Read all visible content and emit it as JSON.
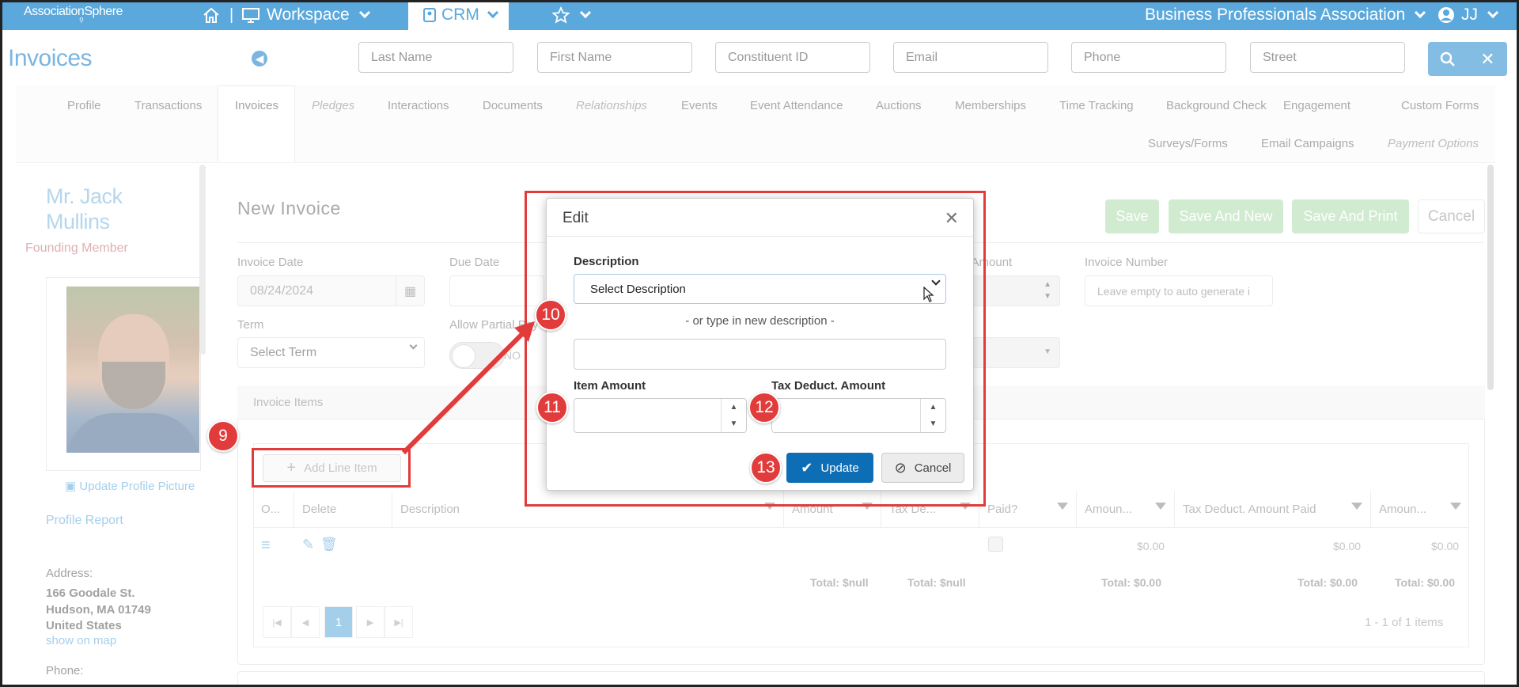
{
  "topbar": {
    "logo": "AssociationSphere",
    "workspace": "Workspace",
    "crm": "CRM",
    "org": "Business Professionals Association",
    "user": "JJ",
    "icons": [
      "home-icon",
      "desktop-icon",
      "crm-icon",
      "star-icon",
      "user-circle-icon"
    ]
  },
  "page": {
    "title": "Invoices"
  },
  "search": {
    "last_name": "Last Name",
    "first_name": "First Name",
    "constituent_id": "Constituent ID",
    "email": "Email",
    "phone": "Phone",
    "street": "Street"
  },
  "tabs": {
    "row1": [
      "Profile",
      "Transactions",
      "Invoices",
      "Pledges",
      "Interactions",
      "Documents",
      "Relationships",
      "Events",
      "Event Attendance",
      "Auctions",
      "Memberships",
      "Time Tracking",
      "Background Check",
      "Engagement",
      "Custom Forms"
    ],
    "row2": [
      "Surveys/Forms",
      "Email Campaigns",
      "Payment Options"
    ],
    "active": "Invoices"
  },
  "profile": {
    "name_line1": "Mr. Jack",
    "name_line2": "Mullins",
    "member_type": "Founding Member",
    "update_picture": "Update Profile Picture",
    "report": "Profile Report",
    "address_label": "Address:",
    "address1": "166 Goodale St.",
    "address2": "Hudson, MA 01749",
    "address3": "United States",
    "map_link": "show on map",
    "phone_label": "Phone:"
  },
  "form": {
    "title": "New Invoice",
    "save": "Save",
    "save_new": "Save And New",
    "save_print": "Save And Print",
    "cancel": "Cancel",
    "invoice_date_label": "Invoice Date",
    "invoice_date": "08/24/2024",
    "due_date_label": "Due Date",
    "amount_label": ". Amount",
    "invoice_number_label": "Invoice Number",
    "invoice_number_placeholder": "Leave empty to auto generate i",
    "term_label": "Term",
    "term_value": "Select Term",
    "partial_label": "Allow Partial Pay",
    "toggle_text": "NO"
  },
  "items": {
    "title": "Invoice Items",
    "add_line": "Add Line Item",
    "columns": [
      "O...",
      "Delete",
      "Description",
      "Amount",
      "Tax De...",
      "Paid?",
      "Amoun...",
      "Tax Deduct. Amount Paid",
      "Amoun..."
    ],
    "row": {
      "amount_paid": "$0.00",
      "tax_paid": "$0.00",
      "amount_due": "$0.00"
    },
    "totals": {
      "amount": "Total: $null",
      "tax": "Total: $null",
      "amount_paid": "Total: $0.00",
      "tax_paid": "Total: $0.00",
      "amount_due": "Total: $0.00"
    },
    "page": "1",
    "summary": "1 - 1 of 1 items"
  },
  "modal": {
    "title": "Edit",
    "description_label": "Description",
    "select_placeholder": "Select Description",
    "or_text": "- or type in new description -",
    "item_amount_label": "Item Amount",
    "tax_label": "Tax Deduct. Amount",
    "update": "Update",
    "cancel": "Cancel"
  },
  "badges": {
    "b9": "9",
    "b10": "10",
    "b11": "11",
    "b12": "12",
    "b13": "13"
  },
  "colors": {
    "brand": "#5aa8dc",
    "annotation": "#e23b3b",
    "update": "#0e6eb5",
    "save": "#5cb85c"
  }
}
